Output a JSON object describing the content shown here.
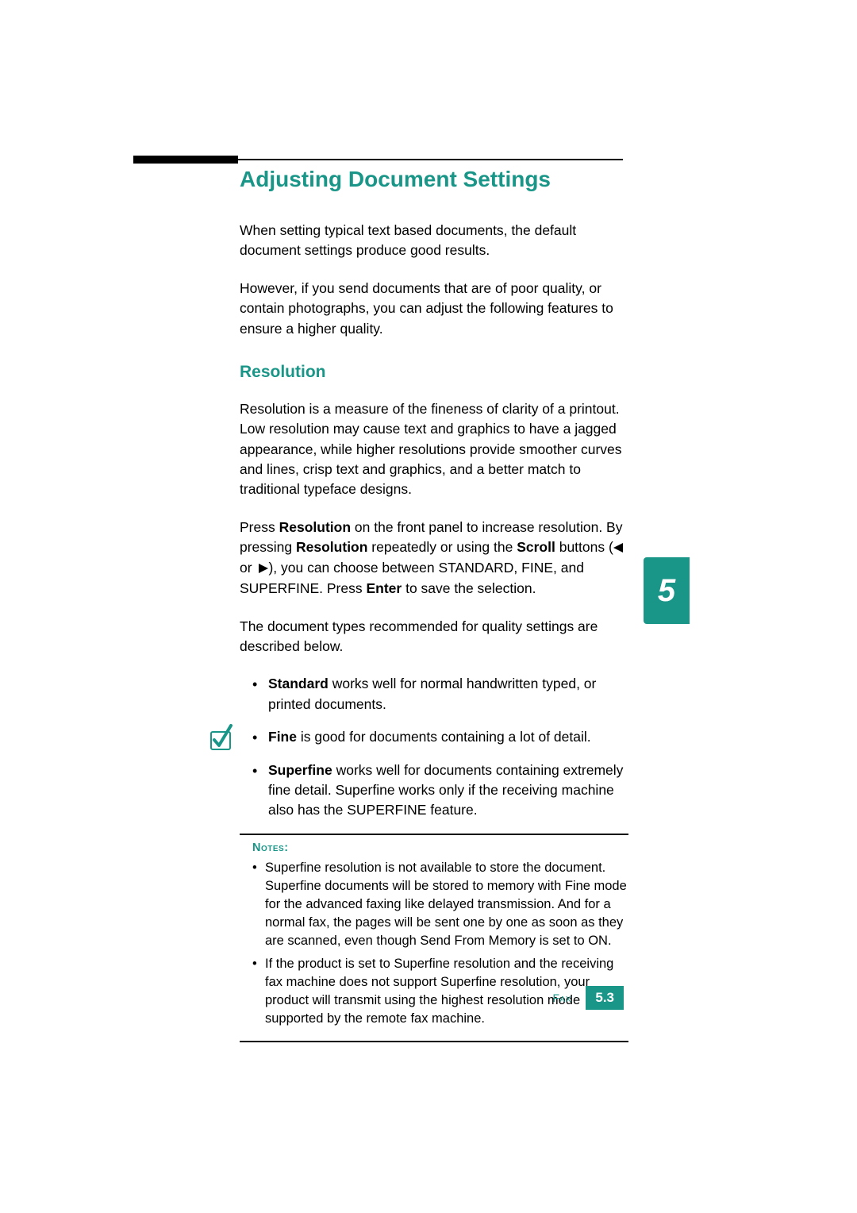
{
  "heading": "Adjusting Document Settings",
  "para1": "When setting typical text based documents, the default document settings produce good results.",
  "para2": "However, if you send documents that are of poor quality, or contain photographs, you can adjust the following features to ensure a higher quality.",
  "subheading": "Resolution",
  "para3": "Resolution is a measure of the fineness of clarity of a printout. Low resolution may cause text and graphics to have a jagged appearance, while higher resolutions provide smoother curves and lines, crisp text and graphics, and a better match to traditional typeface designs.",
  "para4": {
    "s1": "Press ",
    "b1": "Resolution",
    "s2": " on the front panel to increase resolution. By pressing ",
    "b2": "Resolution",
    "s3": " repeatedly or using the ",
    "b3": "Scroll",
    "s4": " buttons (",
    "s5": " or ",
    "s6": "), you can choose between STANDARD, FINE, and SUPERFINE. Press ",
    "b4": "Enter",
    "s7": " to save the selection."
  },
  "para5": "The document types recommended for quality settings are described below.",
  "bullets": {
    "item1": {
      "b": "Standard",
      "rest": " works well for normal handwritten typed, or printed documents."
    },
    "item2": {
      "b": "Fine",
      "rest": " is good for documents containing a lot of detail."
    },
    "item3": {
      "b": "Superfine",
      "rest": " works well for documents containing extremely fine detail. Superfine works only if the receiving machine also has the SUPERFINE feature."
    }
  },
  "notes": {
    "label": "Notes:",
    "n1": "Superfine resolution is not available to store the document. Superfine documents will be stored to memory with Fine mode for the advanced faxing like delayed transmission. And for a normal fax, the pages will be sent one by one as soon as they are scanned, even though Send From Memory is set to ON.",
    "n2": "If the product is set to Superfine resolution and the receiving fax machine does not support Superfine resolution, your product will transmit using the highest resolution mode supported by the remote fax machine."
  },
  "sideTab": "5",
  "footer": {
    "label": "Fax",
    "page": "5.3"
  }
}
